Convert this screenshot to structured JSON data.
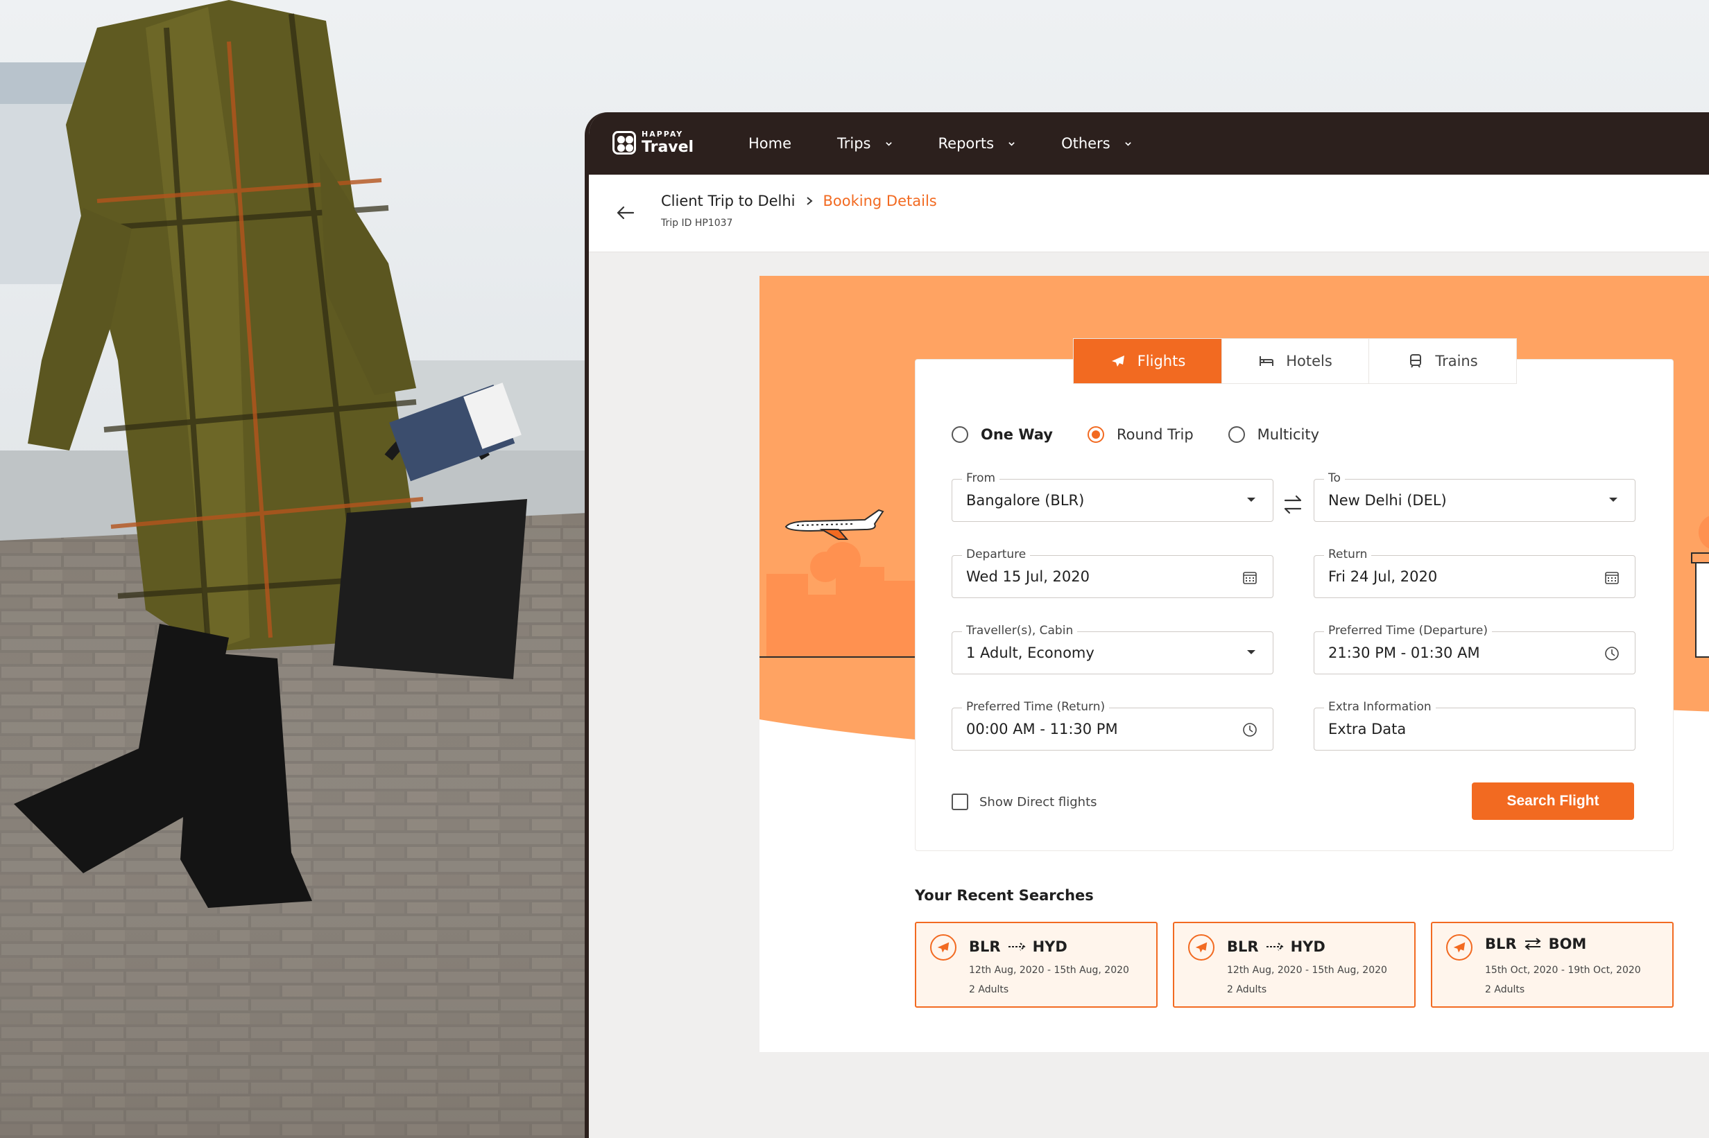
{
  "brand": {
    "small": "HAPPAY",
    "name": "Travel"
  },
  "nav": [
    {
      "label": "Home",
      "dropdown": false
    },
    {
      "label": "Trips",
      "dropdown": true
    },
    {
      "label": "Reports",
      "dropdown": true
    },
    {
      "label": "Others",
      "dropdown": true
    }
  ],
  "breadcrumb": {
    "parent": "Client Trip to Delhi",
    "current": "Booking Details",
    "trip_id": "Trip ID HP1037"
  },
  "tabs": [
    {
      "label": "Flights",
      "icon": "plane-icon",
      "active": true
    },
    {
      "label": "Hotels",
      "icon": "bed-icon",
      "active": false
    },
    {
      "label": "Trains",
      "icon": "train-icon",
      "active": false
    }
  ],
  "trip_type": [
    {
      "label": "One Way",
      "selected": false
    },
    {
      "label": "Round Trip",
      "selected": true
    },
    {
      "label": "Multicity",
      "selected": false
    }
  ],
  "form": {
    "from": {
      "label": "From",
      "value": "Bangalore (BLR)"
    },
    "to": {
      "label": "To",
      "value": "New Delhi (DEL)"
    },
    "departure": {
      "label": "Departure",
      "value": "Wed 15 Jul, 2020"
    },
    "return": {
      "label": "Return",
      "value": "Fri 24 Jul, 2020"
    },
    "travellers": {
      "label": "Traveller(s), Cabin",
      "value": "1 Adult, Economy"
    },
    "pref_departure": {
      "label": "Preferred Time (Departure)",
      "value": "21:30 PM - 01:30 AM"
    },
    "pref_return": {
      "label": "Preferred Time (Return)",
      "value": "00:00 AM - 11:30 PM"
    },
    "extra": {
      "label": "Extra Information",
      "value": "Extra Data"
    },
    "direct_label": "Show Direct flights",
    "search_label": "Search Flight"
  },
  "recent": {
    "title": "Your Recent Searches",
    "items": [
      {
        "from": "BLR",
        "to": "HYD",
        "round_trip": false,
        "dates": "12th Aug, 2020 - 15th Aug, 2020",
        "pax": "2 Adults"
      },
      {
        "from": "BLR",
        "to": "HYD",
        "round_trip": false,
        "dates": "12th Aug, 2020 - 15th Aug, 2020",
        "pax": "2 Adults"
      },
      {
        "from": "BLR",
        "to": "BOM",
        "round_trip": true,
        "dates": "15th Oct, 2020 - 19th Oct, 2020",
        "pax": "2 Adults"
      }
    ]
  },
  "colors": {
    "accent": "#f26a21",
    "topbar": "#2c201d",
    "hero": "#ffa362"
  }
}
